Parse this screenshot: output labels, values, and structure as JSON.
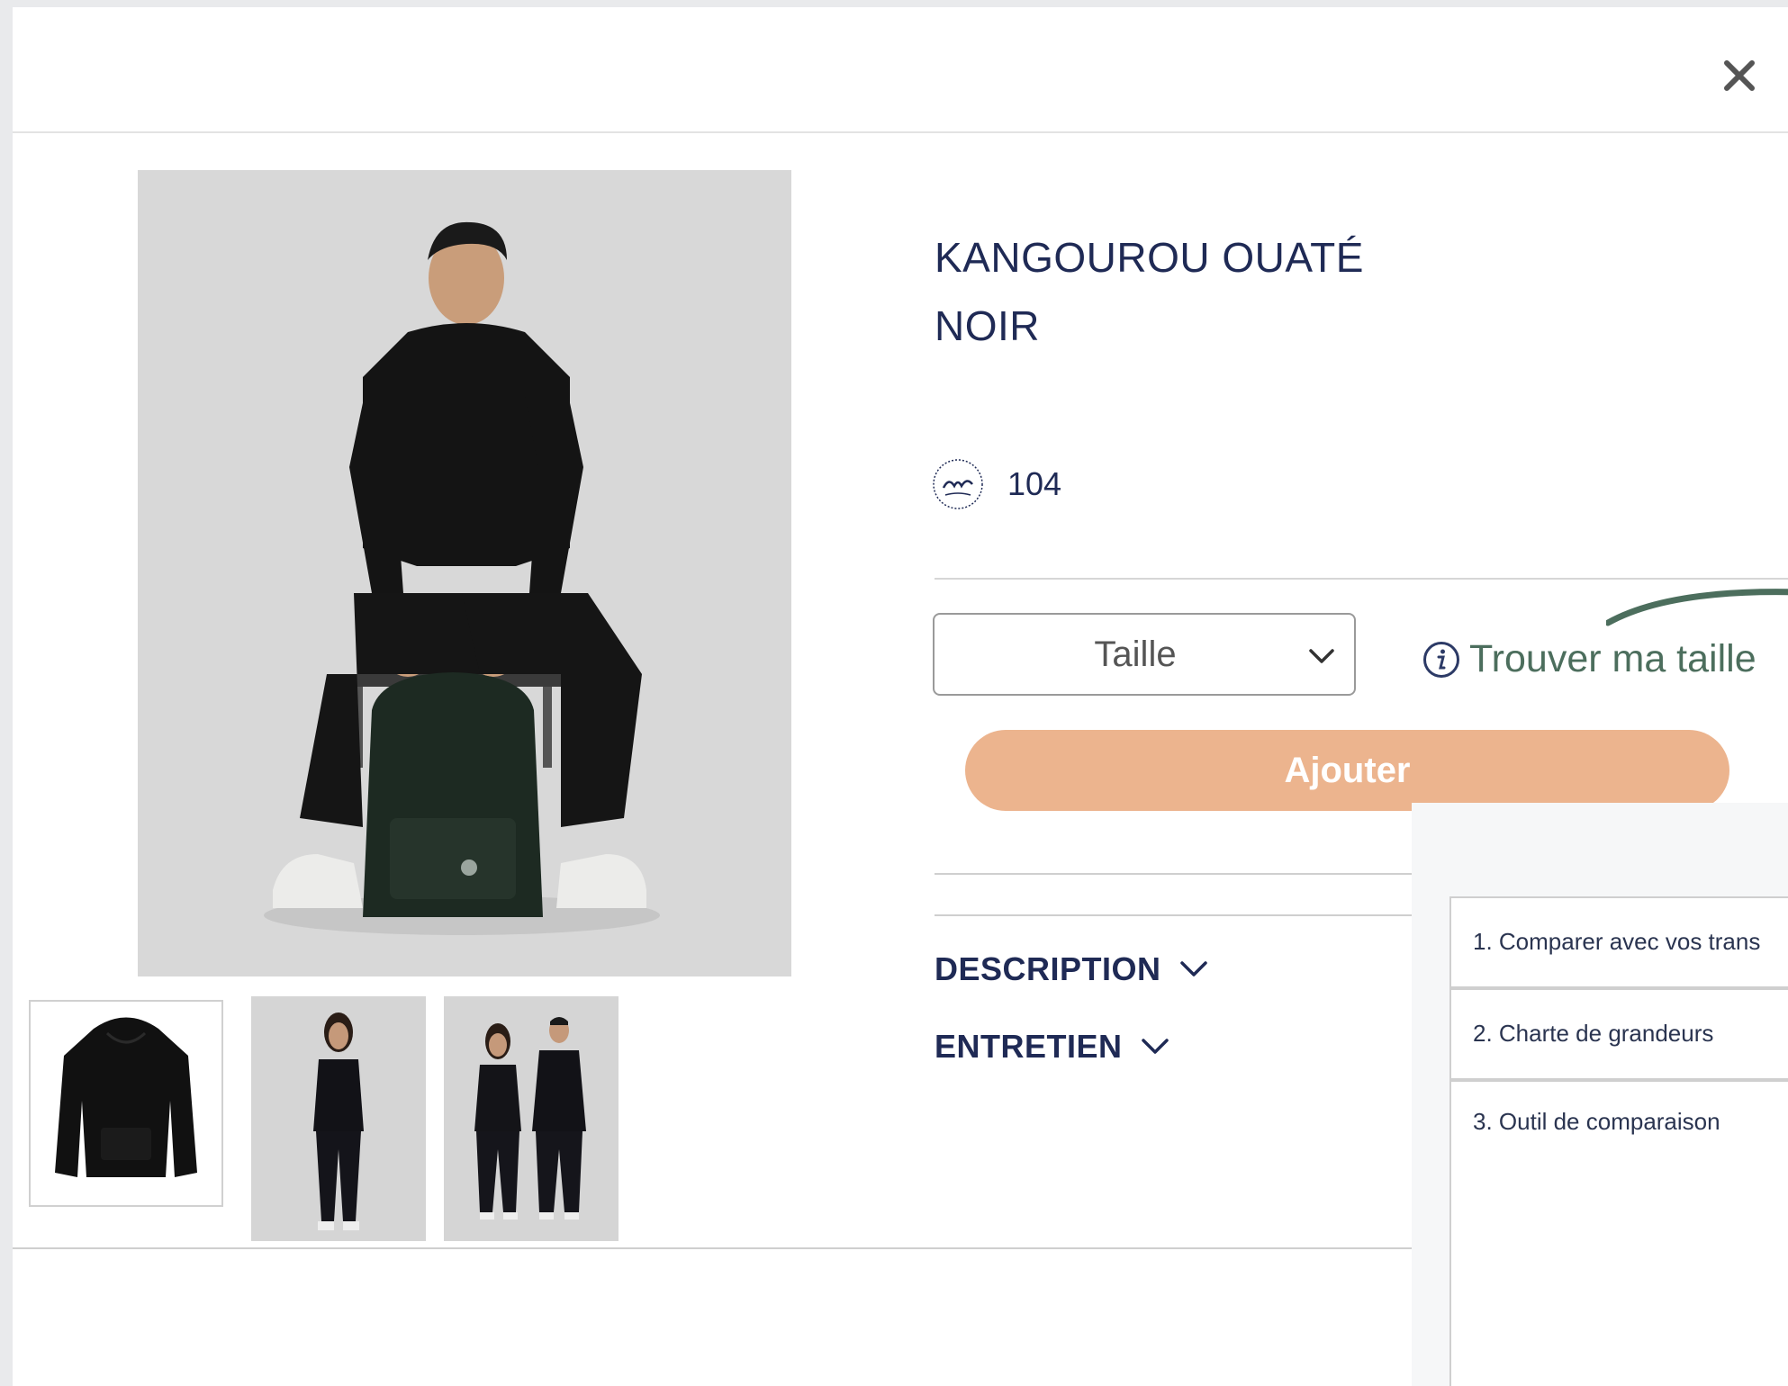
{
  "product": {
    "title_line1": "KANGOUROU OUATÉ",
    "title_line2": "NOIR",
    "points": "104",
    "points_logo_icon": "points-u-badge-icon"
  },
  "size_selector": {
    "label": "Taille"
  },
  "find_size": {
    "label": "Trouver ma taille"
  },
  "add_button": {
    "label": "Ajouter"
  },
  "accordions": {
    "description": "DESCRIPTION",
    "care": "ENTRETIEN"
  },
  "size_guide_panel": {
    "items": [
      "1. Comparer avec vos trans",
      "2. Charte de grandeurs",
      "3. Outil de comparaison"
    ]
  },
  "colors": {
    "title": "#1f2a55",
    "accent_button": "#ecb48e",
    "find_size_green": "#4c6e5d"
  }
}
